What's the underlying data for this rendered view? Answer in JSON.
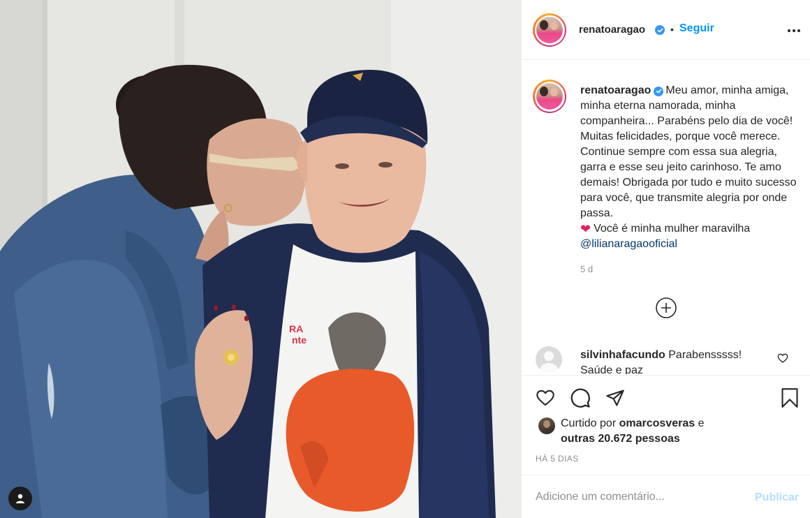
{
  "post": {
    "username": "renatoaragao",
    "verified": true,
    "follow_label": "Seguir",
    "separator": "•",
    "more_icon": "more-horizontal-icon"
  },
  "caption": {
    "username": "renatoaragao",
    "text": "Meu amor, minha amiga, minha eterna namorada, minha companheira... Parabéns pelo dia de você! Muitas felicidades, porque você merece. Continue sempre com essa sua alegria, garra e esse seu jeito carinhoso. Te amo demais! Obrigada por tudo e muito sucesso para você, que transmite alegria por onde passa.",
    "emoji": "❤",
    "text_after_emoji": "Você é minha mulher maravilha",
    "mention": "@lilianaragaooficial",
    "time": "5 d"
  },
  "comments": [
    {
      "username": "silvinhafacundo",
      "text": "Parabensssss! Saúde e paz"
    }
  ],
  "actions": {
    "like_icon": "heart-outline-icon",
    "comment_icon": "comment-bubble-icon",
    "share_icon": "paper-plane-icon",
    "save_icon": "bookmark-icon",
    "load_more_icon": "plus-circle-icon"
  },
  "likes": {
    "prefix": "Curtido por",
    "user": "omarcosveras",
    "conjunction": "e",
    "others": "outras 20.672 pessoas"
  },
  "date": "HÁ 5 DIAS",
  "comment_input": {
    "placeholder": "Adicione um comentário...",
    "value": "",
    "publish_label": "Publicar"
  },
  "colors": {
    "accent": "#0095f6",
    "publish_disabled": "#b2dffc",
    "verified": "#3897f0",
    "text": "#262626",
    "muted": "#8e8e8e",
    "mention": "#00376b",
    "heart": "#e0245e"
  }
}
